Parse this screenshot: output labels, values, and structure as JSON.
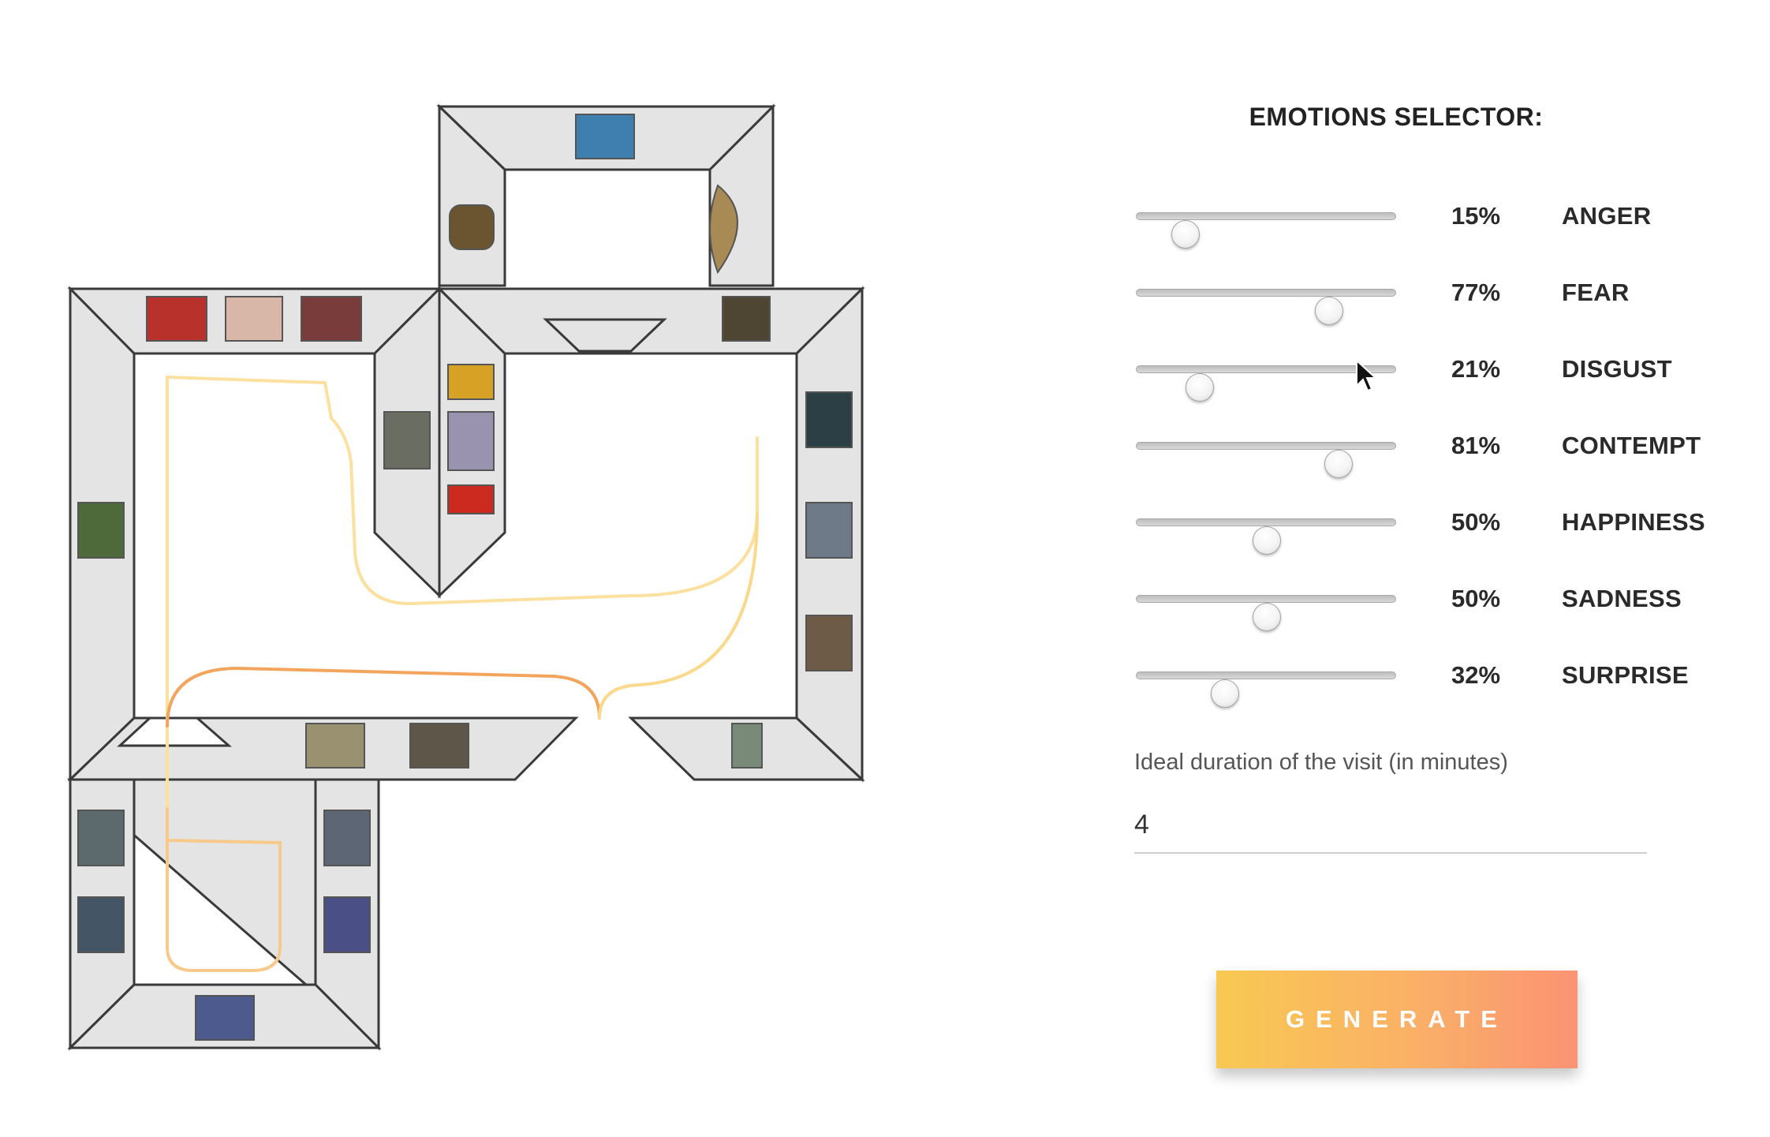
{
  "panel": {
    "title": "EMOTIONS SELECTOR:"
  },
  "emotions": [
    {
      "label": "ANGER",
      "value": 15,
      "value_text": "15%"
    },
    {
      "label": "FEAR",
      "value": 77,
      "value_text": "77%"
    },
    {
      "label": "DISGUST",
      "value": 21,
      "value_text": "21%"
    },
    {
      "label": "CONTEMPT",
      "value": 81,
      "value_text": "81%"
    },
    {
      "label": "HAPPINESS",
      "value": 50,
      "value_text": "50%"
    },
    {
      "label": "SADNESS",
      "value": 50,
      "value_text": "50%"
    },
    {
      "label": "SURPRISE",
      "value": 32,
      "value_text": "32%"
    }
  ],
  "duration": {
    "label": "Ideal duration of the visit (in minutes)",
    "value": "4"
  },
  "generate": {
    "label": "GENERATE"
  },
  "colors": {
    "path_start": "#f9dc8a",
    "path_end": "#f2a45c",
    "button_gradient": [
      "#f8c952",
      "#fb9374"
    ]
  }
}
